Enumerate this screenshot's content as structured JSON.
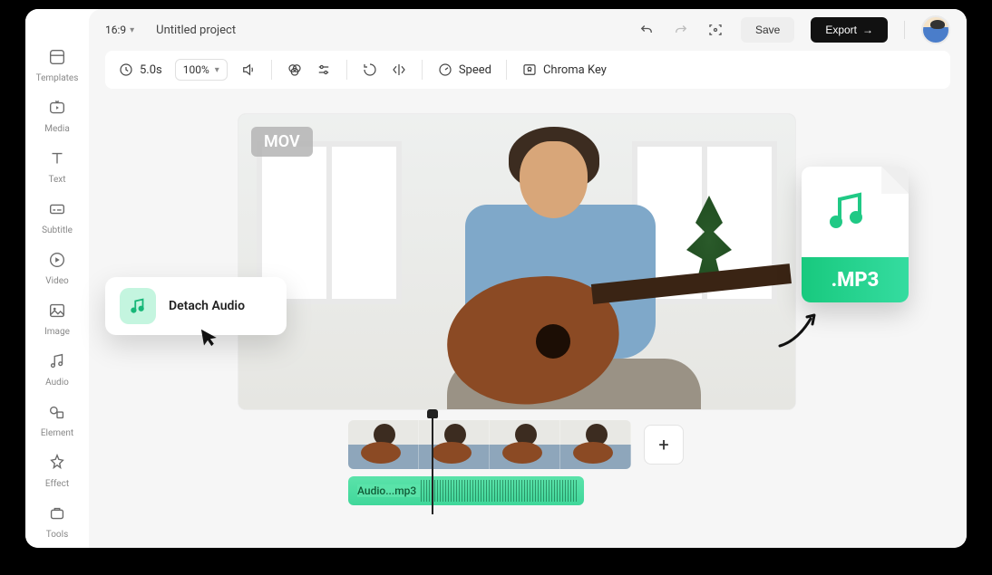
{
  "sidebar": {
    "items": [
      {
        "label": "Templates"
      },
      {
        "label": "Media"
      },
      {
        "label": "Text"
      },
      {
        "label": "Subtitle"
      },
      {
        "label": "Video"
      },
      {
        "label": "Image"
      },
      {
        "label": "Audio"
      },
      {
        "label": "Element"
      },
      {
        "label": "Effect"
      },
      {
        "label": "Tools"
      }
    ]
  },
  "header": {
    "aspect": "16:9",
    "project_title": "Untitled project",
    "save_label": "Save",
    "export_label": "Export"
  },
  "toolbar": {
    "time": "5.0s",
    "zoom": "100%",
    "speed_label": "Speed",
    "chroma_label": "Chroma Key"
  },
  "preview": {
    "format_badge": "MOV"
  },
  "context_card": {
    "detach_label": "Detach Audio"
  },
  "mp3": {
    "ext_label": ".MP3"
  },
  "timeline": {
    "audio_clip_label": "Audio...mp3",
    "add_label": "+"
  }
}
